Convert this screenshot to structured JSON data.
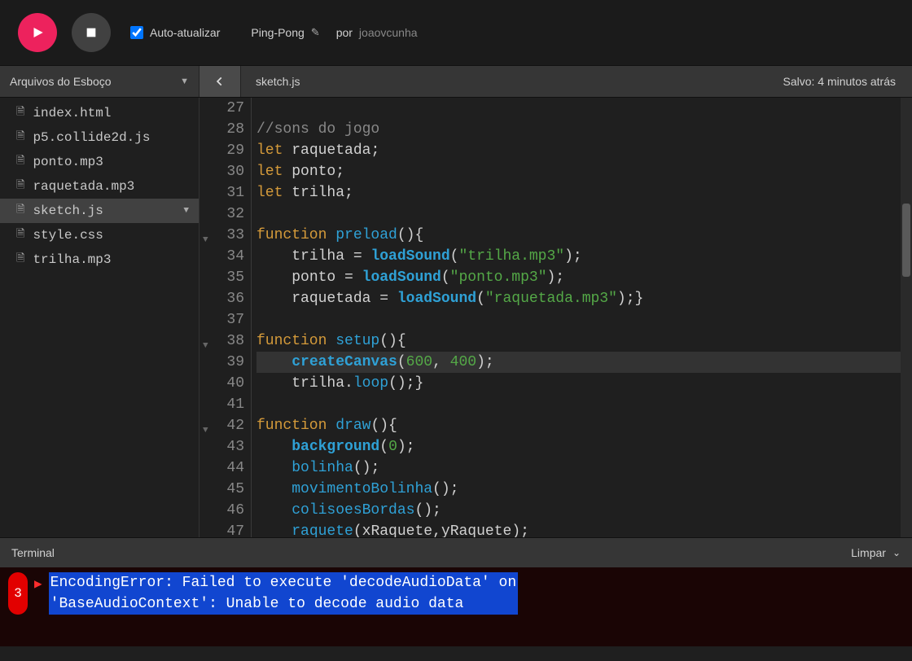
{
  "toolbar": {
    "auto_update_label": "Auto-atualizar",
    "auto_update_checked": true,
    "project_name": "Ping-Pong",
    "by_label": "por",
    "author": "joaovcunha"
  },
  "secbar": {
    "files_header": "Arquivos do Esboço",
    "current_file": "sketch.js",
    "saved_status": "Salvo: 4 minutos atrás"
  },
  "files": [
    {
      "name": "index.html",
      "selected": false
    },
    {
      "name": "p5.collide2d.js",
      "selected": false
    },
    {
      "name": "ponto.mp3",
      "selected": false
    },
    {
      "name": "raquetada.mp3",
      "selected": false
    },
    {
      "name": "sketch.js",
      "selected": true
    },
    {
      "name": "style.css",
      "selected": false
    },
    {
      "name": "trilha.mp3",
      "selected": false
    }
  ],
  "editor": {
    "first_line": 27,
    "highlight_line": 39,
    "fold_lines": [
      33,
      38,
      42
    ],
    "lines": [
      [],
      [
        {
          "t": "comment",
          "v": "//sons do jogo"
        }
      ],
      [
        {
          "t": "key",
          "v": "let "
        },
        {
          "t": "ident",
          "v": "raquetada"
        },
        {
          "t": "punc",
          "v": ";"
        }
      ],
      [
        {
          "t": "key",
          "v": "let "
        },
        {
          "t": "ident",
          "v": "ponto"
        },
        {
          "t": "punc",
          "v": ";"
        }
      ],
      [
        {
          "t": "key",
          "v": "let "
        },
        {
          "t": "ident",
          "v": "trilha"
        },
        {
          "t": "punc",
          "v": ";"
        }
      ],
      [],
      [
        {
          "t": "key",
          "v": "function "
        },
        {
          "t": "func",
          "v": "preload"
        },
        {
          "t": "punc",
          "v": "(){"
        }
      ],
      [
        {
          "t": "punc",
          "v": "    "
        },
        {
          "t": "ident",
          "v": "trilha"
        },
        {
          "t": "punc",
          "v": " = "
        },
        {
          "t": "builtin",
          "v": "loadSound"
        },
        {
          "t": "punc",
          "v": "("
        },
        {
          "t": "str",
          "v": "\"trilha.mp3\""
        },
        {
          "t": "punc",
          "v": ");"
        }
      ],
      [
        {
          "t": "punc",
          "v": "    "
        },
        {
          "t": "ident",
          "v": "ponto"
        },
        {
          "t": "punc",
          "v": " = "
        },
        {
          "t": "builtin",
          "v": "loadSound"
        },
        {
          "t": "punc",
          "v": "("
        },
        {
          "t": "str",
          "v": "\"ponto.mp3\""
        },
        {
          "t": "punc",
          "v": ");"
        }
      ],
      [
        {
          "t": "punc",
          "v": "    "
        },
        {
          "t": "ident",
          "v": "raquetada"
        },
        {
          "t": "punc",
          "v": " = "
        },
        {
          "t": "builtin",
          "v": "loadSound"
        },
        {
          "t": "punc",
          "v": "("
        },
        {
          "t": "str",
          "v": "\"raquetada.mp3\""
        },
        {
          "t": "punc",
          "v": ");}"
        }
      ],
      [],
      [
        {
          "t": "key",
          "v": "function "
        },
        {
          "t": "func",
          "v": "setup"
        },
        {
          "t": "punc",
          "v": "(){"
        }
      ],
      [
        {
          "t": "punc",
          "v": "    "
        },
        {
          "t": "builtin",
          "v": "createCanvas"
        },
        {
          "t": "punc",
          "v": "("
        },
        {
          "t": "num",
          "v": "600"
        },
        {
          "t": "punc",
          "v": ", "
        },
        {
          "t": "num",
          "v": "400"
        },
        {
          "t": "punc",
          "v": ");"
        }
      ],
      [
        {
          "t": "punc",
          "v": "    "
        },
        {
          "t": "ident",
          "v": "trilha"
        },
        {
          "t": "punc",
          "v": "."
        },
        {
          "t": "func",
          "v": "loop"
        },
        {
          "t": "punc",
          "v": "();}"
        }
      ],
      [],
      [
        {
          "t": "key",
          "v": "function "
        },
        {
          "t": "func",
          "v": "draw"
        },
        {
          "t": "punc",
          "v": "(){"
        }
      ],
      [
        {
          "t": "punc",
          "v": "    "
        },
        {
          "t": "builtin",
          "v": "background"
        },
        {
          "t": "punc",
          "v": "("
        },
        {
          "t": "num",
          "v": "0"
        },
        {
          "t": "punc",
          "v": ");"
        }
      ],
      [
        {
          "t": "punc",
          "v": "    "
        },
        {
          "t": "func",
          "v": "bolinha"
        },
        {
          "t": "punc",
          "v": "();"
        }
      ],
      [
        {
          "t": "punc",
          "v": "    "
        },
        {
          "t": "func",
          "v": "movimentoBolinha"
        },
        {
          "t": "punc",
          "v": "();"
        }
      ],
      [
        {
          "t": "punc",
          "v": "    "
        },
        {
          "t": "func",
          "v": "colisoesBordas"
        },
        {
          "t": "punc",
          "v": "();"
        }
      ],
      [
        {
          "t": "punc",
          "v": "    "
        },
        {
          "t": "func",
          "v": "raquete"
        },
        {
          "t": "punc",
          "v": "("
        },
        {
          "t": "ident",
          "v": "xRaquete"
        },
        {
          "t": "punc",
          "v": ","
        },
        {
          "t": "ident",
          "v": "yRaquete"
        },
        {
          "t": "punc",
          "v": ");"
        }
      ]
    ]
  },
  "console": {
    "title": "Terminal",
    "clear_label": "Limpar",
    "error_count": "3",
    "error_line1": "EncodingError: Failed to execute 'decodeAudioData' on ",
    "error_line2": "'BaseAudioContext': Unable to decode audio data"
  }
}
